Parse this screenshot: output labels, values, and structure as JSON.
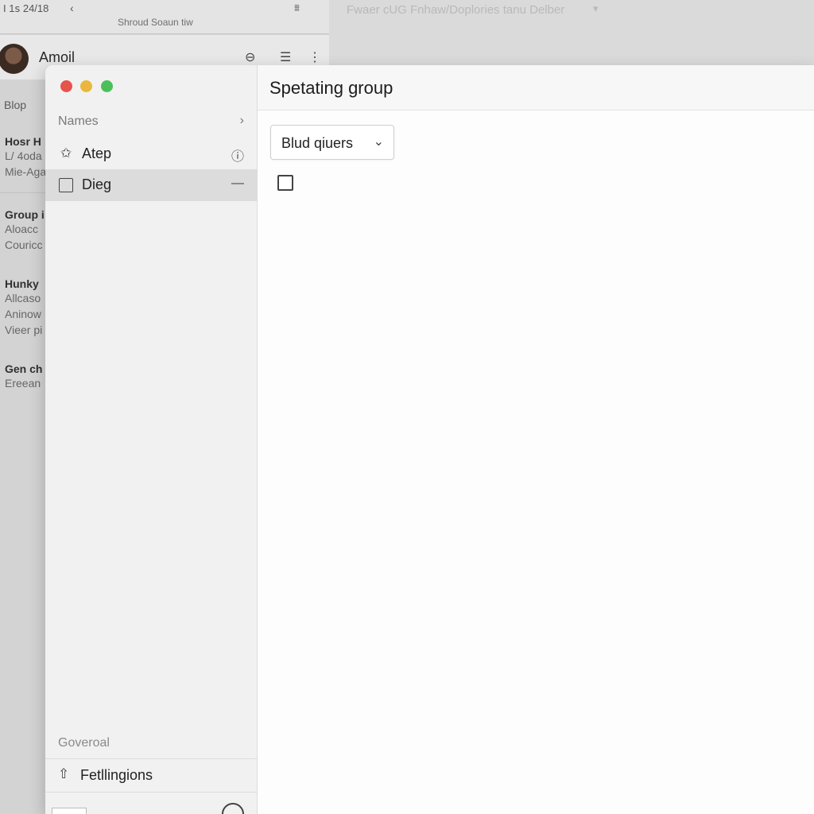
{
  "background_window": {
    "status_time": "I 1ꜱ 24/18",
    "status_subtitle": "Shroud Soaun tiw",
    "user_name": "Amoil",
    "section_label": "Blop",
    "right_title": "Fwaer cUG Fnhaw/Doplories tanu Delber",
    "list": [
      {
        "title": "Hosr H",
        "lines": [
          "L/ 4oda",
          "Mie-Aga"
        ]
      },
      {
        "title": "Group i",
        "lines": [
          "Aloacc",
          "Couricc"
        ]
      },
      {
        "title": "Hunky",
        "lines": [
          "Allcaso",
          "Aninow",
          "Vieer pi"
        ]
      },
      {
        "title": "Gen ch",
        "lines": [
          "Ereean"
        ]
      }
    ]
  },
  "window": {
    "sidebar": {
      "names_label": "Names",
      "items": [
        {
          "label": "Atep",
          "icon": "star-icon",
          "trail": "ⓘ"
        },
        {
          "label": "Dieg",
          "icon": "grid-icon",
          "trail": "—"
        }
      ],
      "footer_label": "Goverоal",
      "footer_item": "Fetllingions"
    },
    "content": {
      "title": "Spetating group",
      "dropdown_value": "Blud qiuers"
    }
  },
  "colors": {
    "traffic_red": "#e5534b",
    "traffic_yellow": "#e9b73c",
    "traffic_green": "#4bbf5a",
    "selection": "#dcdcdc"
  }
}
